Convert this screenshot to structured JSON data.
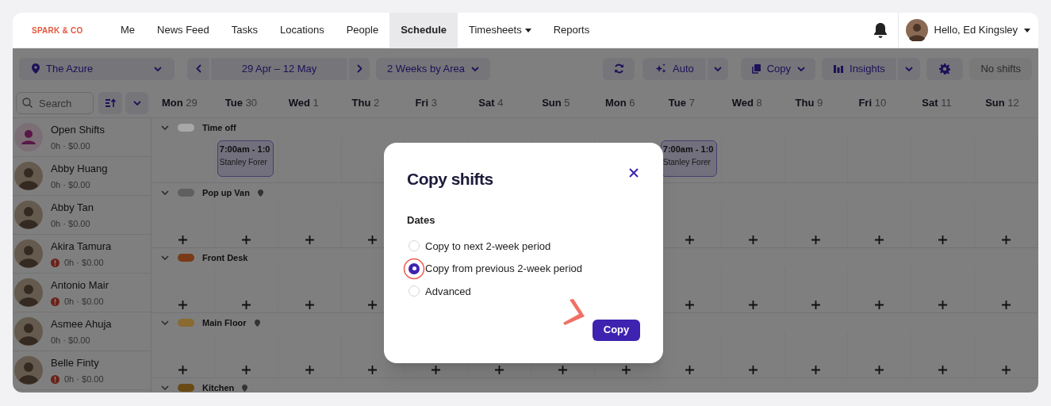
{
  "brand": "SPARK & CO",
  "nav": [
    {
      "label": "Me",
      "selected": false,
      "dropdown": false
    },
    {
      "label": "News Feed",
      "selected": false,
      "dropdown": false
    },
    {
      "label": "Tasks",
      "selected": false,
      "dropdown": false
    },
    {
      "label": "Locations",
      "selected": false,
      "dropdown": false
    },
    {
      "label": "People",
      "selected": false,
      "dropdown": false
    },
    {
      "label": "Schedule",
      "selected": true,
      "dropdown": false
    },
    {
      "label": "Timesheets",
      "selected": false,
      "dropdown": true
    },
    {
      "label": "Reports",
      "selected": false,
      "dropdown": false
    }
  ],
  "user": {
    "greeting": "Hello, Ed Kingsley"
  },
  "toolbar": {
    "location": "The Azure",
    "date_range": "29 Apr – 12 May",
    "view": "2 Weeks by Area",
    "auto": "Auto",
    "copy": "Copy",
    "insights": "Insights",
    "status": "No shifts"
  },
  "search": {
    "placeholder": "Search"
  },
  "days": [
    {
      "name": "Mon",
      "date": "29"
    },
    {
      "name": "Tue",
      "date": "30",
      "time_off_shifts": [
        {
          "time": "7:00am - 1:0",
          "person": "Stanley Forer"
        }
      ]
    },
    {
      "name": "Wed",
      "date": "1"
    },
    {
      "name": "Thu",
      "date": "2"
    },
    {
      "name": "Fri",
      "date": "3"
    },
    {
      "name": "Sat",
      "date": "4"
    },
    {
      "name": "Sun",
      "date": "5"
    },
    {
      "name": "Mon",
      "date": "6"
    },
    {
      "name": "Tue",
      "date": "7",
      "time_off_shifts": [
        {
          "time": "7:00am - 1:0",
          "person": "Stanley Forer"
        }
      ]
    },
    {
      "name": "Wed",
      "date": "8"
    },
    {
      "name": "Thu",
      "date": "9"
    },
    {
      "name": "Fri",
      "date": "10"
    },
    {
      "name": "Sat",
      "date": "11"
    },
    {
      "name": "Sun",
      "date": "12"
    }
  ],
  "people": [
    {
      "kind": "open",
      "name": "Open Shifts",
      "summary": "0h · $0.00",
      "warning": false
    },
    {
      "kind": "person",
      "name": "Abby Huang",
      "summary": "0h · $0.00",
      "warning": false
    },
    {
      "kind": "person",
      "name": "Abby Tan",
      "summary": "0h · $0.00",
      "warning": false
    },
    {
      "kind": "person",
      "name": "Akira Tamura",
      "summary": "0h · $0.00",
      "warning": true
    },
    {
      "kind": "person",
      "name": "Antonio Mair",
      "summary": "0h · $0.00",
      "warning": true
    },
    {
      "kind": "person",
      "name": "Asmee Ahuja",
      "summary": "0h · $0.00",
      "warning": false
    },
    {
      "kind": "person",
      "name": "Belle Finty",
      "summary": "0h · $0.00",
      "warning": true
    }
  ],
  "areas": [
    {
      "kind": "time_off",
      "name": "Time off",
      "color": "#a8a8a8",
      "pin": false
    },
    {
      "kind": "area",
      "name": "Pop up Van",
      "color": "#5f5f5f",
      "pin": true
    },
    {
      "kind": "area",
      "name": "Front Desk",
      "color": "#7a3a18",
      "pin": false
    },
    {
      "kind": "area",
      "name": "Main Floor",
      "color": "#8a6a30",
      "pin": true
    },
    {
      "kind": "area",
      "name": "Kitchen",
      "color": "#6a4a14",
      "pin": true
    }
  ],
  "dialog": {
    "title": "Copy shifts",
    "section": "Dates",
    "options": [
      {
        "label": "Copy to next 2-week period",
        "selected": false
      },
      {
        "label": "Copy from previous 2-week period",
        "selected": true
      },
      {
        "label": "Advanced",
        "selected": false
      }
    ],
    "confirm": "Copy"
  }
}
